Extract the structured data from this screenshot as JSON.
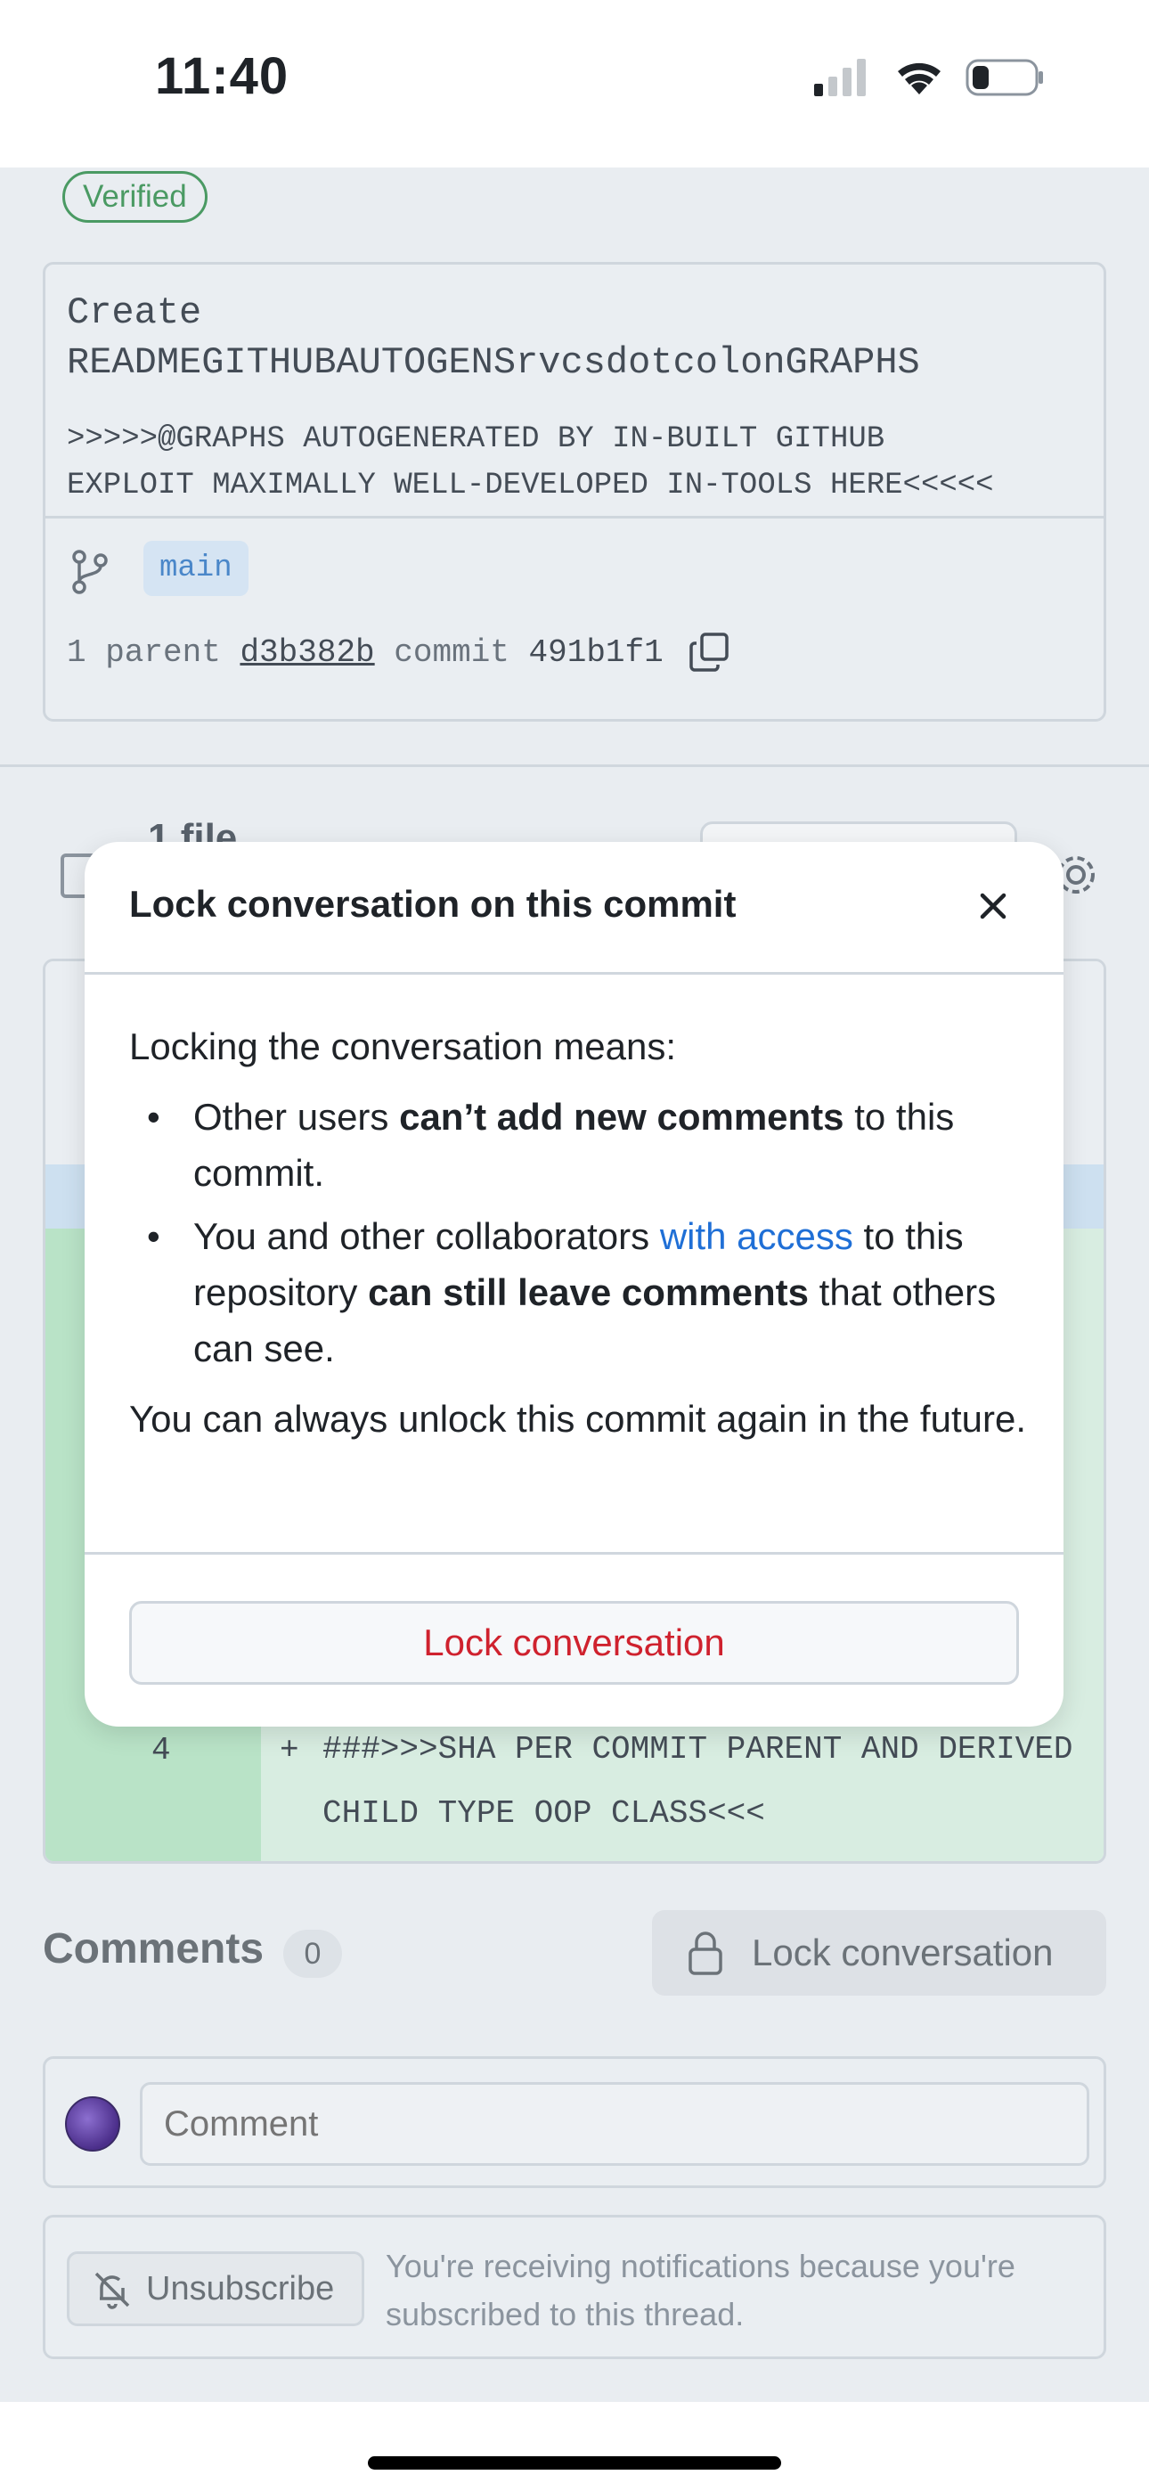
{
  "status_bar": {
    "time": "11:40",
    "icons": [
      "signal-icon",
      "wifi-icon",
      "battery-icon"
    ]
  },
  "commit": {
    "verified_label": "Verified",
    "title_line1": "Create",
    "title_line2": "READMEGITHUBAUTOGENSrvcsdotcolonGRAPHS",
    "body_line1": ">>>>>@GRAPHS AUTOGENERATED BY IN-BUILT GITHUB",
    "body_line2": "EXPLOIT MAXIMALLY WELL-DEVELOPED IN-TOOLS HERE<<<<<",
    "branch": "main",
    "parent_label": "1 parent",
    "parent_sha": "d3b382b",
    "commit_label": "commit",
    "commit_sha": "491b1f1"
  },
  "files": {
    "count_label": "1 file"
  },
  "diff": {
    "line_number": "4",
    "line_sign": "+",
    "line_text": "###>>>SHA PER COMMIT PARENT AND DERIVED CHILD TYPE OOP CLASS<<<"
  },
  "comments": {
    "heading": "Comments",
    "count": "0",
    "lock_button_label": "Lock conversation",
    "input_placeholder": "Comment",
    "unsubscribe_label": "Unsubscribe",
    "subscription_note": "You're receiving notifications because you're subscribed to this thread."
  },
  "modal": {
    "title": "Lock conversation on this commit",
    "intro": "Locking the conversation means:",
    "bullet1_pre": "Other users ",
    "bullet1_bold": "can’t add new comments",
    "bullet1_post": " to this commit.",
    "bullet2_pre": "You and other collaborators ",
    "bullet2_link": "with access",
    "bullet2_mid": " to this repository ",
    "bullet2_bold": "can still leave comments",
    "bullet2_post": " that others can see.",
    "outro": "You can always unlock this commit again in the future.",
    "confirm_button": "Lock conversation"
  },
  "colors": {
    "danger": "#cf222e",
    "link": "#1f6fd6",
    "verified": "#4a9a63",
    "added_line_bg": "#d8ede1"
  }
}
